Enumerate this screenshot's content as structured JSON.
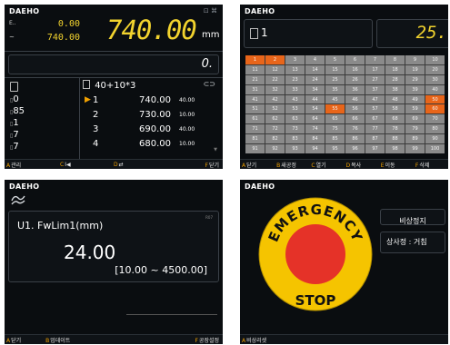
{
  "brand": "DAEHO",
  "p1": {
    "top_icons": "⊡ ⌘",
    "rows": [
      {
        "label": "E..",
        "value": "0.00"
      },
      {
        "label": "~",
        "value": "740.00"
      }
    ],
    "big_value": "740.00",
    "unit": "mm",
    "offset": "0.",
    "stats": [
      "0",
      "85",
      "1",
      "7",
      "7"
    ],
    "program_name": "40+10*3",
    "steps": [
      {
        "n": "1",
        "pos": "740.00",
        "sub": "40.00",
        "active": true
      },
      {
        "n": "2",
        "pos": "730.00",
        "sub": "10.00",
        "active": false
      },
      {
        "n": "3",
        "pos": "690.00",
        "sub": "40.00",
        "active": false
      },
      {
        "n": "4",
        "pos": "680.00",
        "sub": "10.00",
        "active": false
      }
    ],
    "fkeys": [
      {
        "key": "A",
        "label": "관리"
      },
      {
        "key": "C",
        "label": "I◀"
      },
      {
        "key": "D",
        "label": "⇄"
      },
      {
        "key": "F",
        "label": "닫기"
      }
    ]
  },
  "p2": {
    "field_value": "1",
    "big_value": "25.",
    "cells": [
      "1",
      "2",
      "3",
      "4",
      "5",
      "6",
      "7",
      "8",
      "9",
      "10",
      "11",
      "12",
      "13",
      "14",
      "15",
      "16",
      "17",
      "18",
      "19",
      "20",
      "21",
      "22",
      "23",
      "24",
      "25",
      "26",
      "27",
      "28",
      "29",
      "30",
      "31",
      "32",
      "33",
      "34",
      "35",
      "36",
      "37",
      "38",
      "39",
      "40",
      "41",
      "42",
      "43",
      "44",
      "45",
      "46",
      "47",
      "48",
      "49",
      "50",
      "51",
      "52",
      "53",
      "54",
      "55",
      "56",
      "57",
      "58",
      "59",
      "60",
      "61",
      "62",
      "63",
      "64",
      "65",
      "66",
      "67",
      "68",
      "69",
      "70",
      "71",
      "72",
      "73",
      "74",
      "75",
      "76",
      "77",
      "78",
      "79",
      "80",
      "81",
      "82",
      "83",
      "84",
      "85",
      "86",
      "87",
      "88",
      "89",
      "90",
      "91",
      "92",
      "93",
      "94",
      "95",
      "96",
      "97",
      "98",
      "99",
      "100"
    ],
    "highlighted": [
      "1",
      "2",
      "50",
      "55",
      "60"
    ],
    "fkeys": [
      {
        "key": "A",
        "label": "닫기"
      },
      {
        "key": "B",
        "label": "새공정"
      },
      {
        "key": "C",
        "label": "열기"
      },
      {
        "key": "D",
        "label": "복사"
      },
      {
        "key": "E",
        "label": "이동"
      },
      {
        "key": "F",
        "label": "삭제"
      }
    ]
  },
  "p3": {
    "param_label": "U1. FwLim1(mm)",
    "corner": "R07",
    "value": "24.00",
    "range": "[10.00 ~ 4500.00]",
    "fkeys": [
      {
        "key": "A",
        "label": "닫기"
      },
      {
        "key": "B",
        "label": "업데이트"
      },
      {
        "key": "F",
        "label": "공장설정"
      }
    ]
  },
  "p4": {
    "emergency_top": "EMERGENCY",
    "emergency_bottom": "STOP",
    "button1": "비상정지",
    "status": "상사정 : 거침",
    "fkeys": [
      {
        "key": "A",
        "label": "비상리셋"
      }
    ]
  },
  "colors": {
    "accent": "#f0a000",
    "yellow": "#f2d32e",
    "grid_cell": "#8a8a8a",
    "grid_highlight": "#e8651a",
    "emergency_yellow": "#f5c400",
    "emergency_red": "#e53228"
  }
}
